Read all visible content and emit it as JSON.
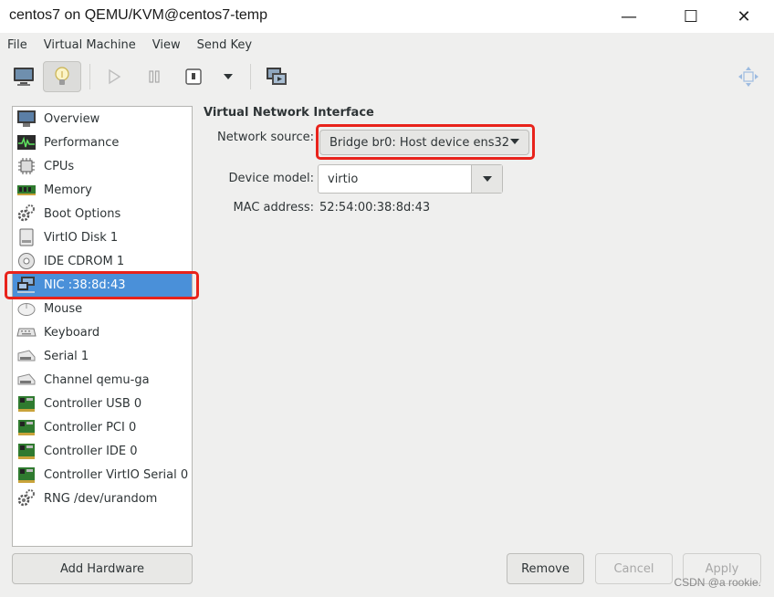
{
  "window": {
    "title": "centos7 on QEMU/KVM@centos7-temp",
    "minimize_glyph": "—",
    "maximize_glyph": "☐",
    "close_glyph": "✕"
  },
  "menu": [
    "File",
    "Virtual Machine",
    "View",
    "Send Key"
  ],
  "toolbar": {
    "icons": [
      "console-icon",
      "details-lightbulb-icon",
      "run-icon",
      "pause-icon",
      "shutdown-icon",
      "shutdown-menu-chevron-icon",
      "snapshots-icon",
      "fullscreen-icon"
    ]
  },
  "hardware_list": [
    {
      "label": "Overview",
      "icon": "overview-icon"
    },
    {
      "label": "Performance",
      "icon": "performance-icon"
    },
    {
      "label": "CPUs",
      "icon": "cpu-icon"
    },
    {
      "label": "Memory",
      "icon": "memory-icon"
    },
    {
      "label": "Boot Options",
      "icon": "gear-icon"
    },
    {
      "label": "VirtIO Disk 1",
      "icon": "disk-icon"
    },
    {
      "label": "IDE CDROM 1",
      "icon": "cdrom-icon"
    },
    {
      "label": "NIC :38:8d:43",
      "icon": "network-icon",
      "selected": true
    },
    {
      "label": "Mouse",
      "icon": "mouse-icon"
    },
    {
      "label": "Keyboard",
      "icon": "keyboard-icon"
    },
    {
      "label": "Serial 1",
      "icon": "serial-icon"
    },
    {
      "label": "Channel qemu-ga",
      "icon": "channel-icon"
    },
    {
      "label": "Controller USB 0",
      "icon": "controller-icon"
    },
    {
      "label": "Controller PCI 0",
      "icon": "controller-icon"
    },
    {
      "label": "Controller IDE 0",
      "icon": "controller-icon"
    },
    {
      "label": "Controller VirtIO Serial 0",
      "icon": "controller-icon"
    },
    {
      "label": "RNG /dev/urandom",
      "icon": "gear-icon"
    }
  ],
  "details": {
    "section_title": "Virtual Network Interface",
    "network_source_label": "Network source:",
    "network_source_value": "Bridge br0: Host device ens32",
    "device_model_label": "Device model:",
    "device_model_value": "virtio",
    "mac_label": "MAC address:",
    "mac_value": "52:54:00:38:8d:43"
  },
  "buttons": {
    "add_hardware": "Add Hardware",
    "remove": "Remove",
    "cancel": "Cancel",
    "apply": "Apply"
  },
  "watermark": "CSDN @a rookie.",
  "colors": {
    "selection": "#4a90d9",
    "highlight_box": "#e8231b"
  }
}
